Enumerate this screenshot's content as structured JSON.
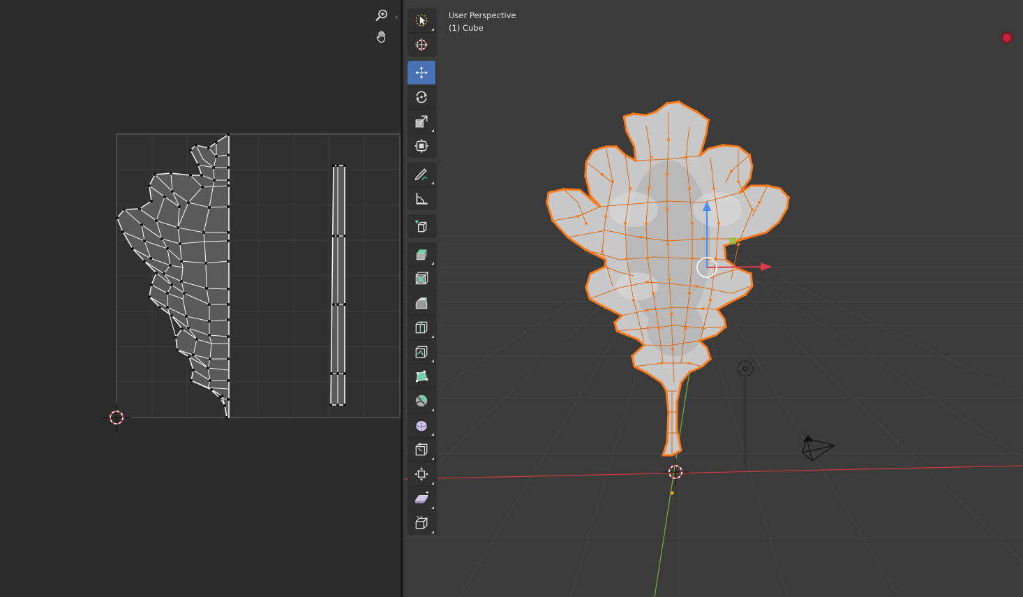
{
  "uv_editor": {
    "nav_icons": [
      "zoom-icon",
      "hand-pan-icon"
    ],
    "collapse_glyph": "‹"
  },
  "viewport": {
    "view_name": "User Perspective",
    "object_label": "(1) Cube",
    "colors": {
      "background": "#3b3b3b",
      "selection_orange": "#ff7a1a",
      "x_axis": "#c43a3a",
      "y_axis": "#7aa63a",
      "active_tool": "#4772b3",
      "record": "#c2223a"
    }
  },
  "toolbar": {
    "groups": [
      [
        {
          "icon": "select-box-icon",
          "active": false,
          "sub": true
        },
        {
          "icon": "cursor-icon",
          "active": false,
          "sub": false
        }
      ],
      [
        {
          "icon": "move-icon",
          "active": true,
          "sub": false
        },
        {
          "icon": "rotate-icon",
          "active": false,
          "sub": false
        },
        {
          "icon": "scale-icon",
          "active": false,
          "sub": true
        },
        {
          "icon": "transform-icon",
          "active": false,
          "sub": false
        }
      ],
      [
        {
          "icon": "annotate-icon",
          "active": false,
          "sub": true
        },
        {
          "icon": "measure-icon",
          "active": false,
          "sub": false
        }
      ],
      [
        {
          "icon": "add-cube-icon",
          "active": false,
          "sub": false
        }
      ],
      [
        {
          "icon": "extrude-icon",
          "active": false,
          "sub": true
        },
        {
          "icon": "inset-icon",
          "active": false,
          "sub": false
        },
        {
          "icon": "bevel-icon",
          "active": false,
          "sub": false
        },
        {
          "icon": "loop-cut-icon",
          "active": false,
          "sub": true
        },
        {
          "icon": "knife-icon",
          "active": false,
          "sub": true
        },
        {
          "icon": "poly-build-icon",
          "active": false,
          "sub": false
        },
        {
          "icon": "spin-icon",
          "active": false,
          "sub": true
        },
        {
          "icon": "smooth-icon",
          "active": false,
          "sub": true
        },
        {
          "icon": "edge-slide-icon",
          "active": false,
          "sub": true
        },
        {
          "icon": "shrink-fatten-icon",
          "active": false,
          "sub": true
        },
        {
          "icon": "shear-icon",
          "active": false,
          "sub": true
        },
        {
          "icon": "rip-region-icon",
          "active": false,
          "sub": true
        }
      ]
    ]
  }
}
